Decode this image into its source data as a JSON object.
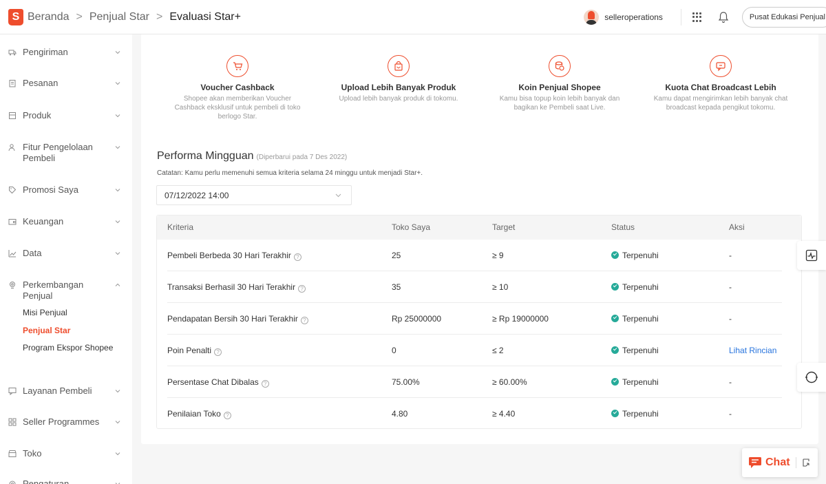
{
  "header": {
    "logo_letter": "S",
    "breadcrumb": [
      "Beranda",
      "Penjual Star",
      "Evaluasi Star+"
    ],
    "separator": ">",
    "username": "selleroperations",
    "edu_button": "Pusat Edukasi Penjual"
  },
  "sidebar": {
    "items": [
      {
        "label": "Pengiriman",
        "icon": "truck-icon"
      },
      {
        "label": "Pesanan",
        "icon": "clipboard-icon"
      },
      {
        "label": "Produk",
        "icon": "box-icon"
      },
      {
        "label": "Fitur Pengelolaan Pembeli",
        "icon": "users-icon"
      },
      {
        "label": "Promosi Saya",
        "icon": "tag-icon"
      },
      {
        "label": "Keuangan",
        "icon": "wallet-icon"
      },
      {
        "label": "Data",
        "icon": "chart-icon"
      },
      {
        "label": "Perkembangan Penjual",
        "icon": "growth-icon"
      },
      {
        "label": "Layanan Pembeli",
        "icon": "chat-bubble-icon"
      },
      {
        "label": "Seller Programmes",
        "icon": "grid-icon"
      },
      {
        "label": "Toko",
        "icon": "shop-icon"
      },
      {
        "label": "Pengaturan",
        "icon": "gear-icon"
      }
    ],
    "sub_items": [
      "Misi Penjual",
      "Penjual Star",
      "Program Ekspor Shopee"
    ],
    "active_sub": "Penjual Star"
  },
  "benefits": [
    {
      "title": "Voucher Cashback",
      "desc": "Shopee akan memberikan Voucher Cashback eksklusif untuk pembeli di toko berlogo Star.",
      "icon": "cart-icon"
    },
    {
      "title": "Upload Lebih Banyak Produk",
      "desc": "Upload lebih banyak produk di tokomu.",
      "icon": "bag-icon"
    },
    {
      "title": "Koin Penjual Shopee",
      "desc": "Kamu bisa topup koin lebih banyak dan bagikan ke Pembeli saat Live.",
      "icon": "coins-icon"
    },
    {
      "title": "Kuota Chat Broadcast Lebih",
      "desc": "Kamu dapat mengirimkan lebih banyak chat broadcast kepada pengikut tokomu.",
      "icon": "megaphone-icon"
    }
  ],
  "performance": {
    "title": "Performa Mingguan",
    "updated": "(Diperbarui pada 7 Des 2022)",
    "note": "Catatan: Kamu perlu memenuhi semua kriteria selama 24 minggu untuk menjadi Star+.",
    "date_value": "07/12/2022 14:00"
  },
  "table": {
    "headers": [
      "Kriteria",
      "Toko Saya",
      "Target",
      "Status",
      "Aksi"
    ],
    "rows": [
      {
        "criteria": "Pembeli Berbeda 30 Hari Terakhir",
        "mine": "25",
        "target": "≥ 9",
        "status": "Terpenuhi",
        "action": "-"
      },
      {
        "criteria": "Transaksi Berhasil 30 Hari Terakhir",
        "mine": "35",
        "target": "≥ 10",
        "status": "Terpenuhi",
        "action": "-"
      },
      {
        "criteria": "Pendapatan Bersih 30 Hari Terakhir",
        "mine": "Rp 25000000",
        "target": "≥ Rp 19000000",
        "status": "Terpenuhi",
        "action": "-"
      },
      {
        "criteria": "Poin Penalti",
        "mine": "0",
        "target": "≤ 2",
        "status": "Terpenuhi",
        "action": "Lihat Rincian"
      },
      {
        "criteria": "Persentase Chat Dibalas",
        "mine": "75.00%",
        "target": "≥ 60.00%",
        "status": "Terpenuhi",
        "action": "-"
      },
      {
        "criteria": "Penilaian Toko",
        "mine": "4.80",
        "target": "≥ 4.40",
        "status": "Terpenuhi",
        "action": "-"
      }
    ]
  },
  "chat": {
    "label": "Chat"
  },
  "colors": {
    "brand": "#ee4d2d",
    "success": "#26aa99",
    "link": "#2673dd"
  }
}
